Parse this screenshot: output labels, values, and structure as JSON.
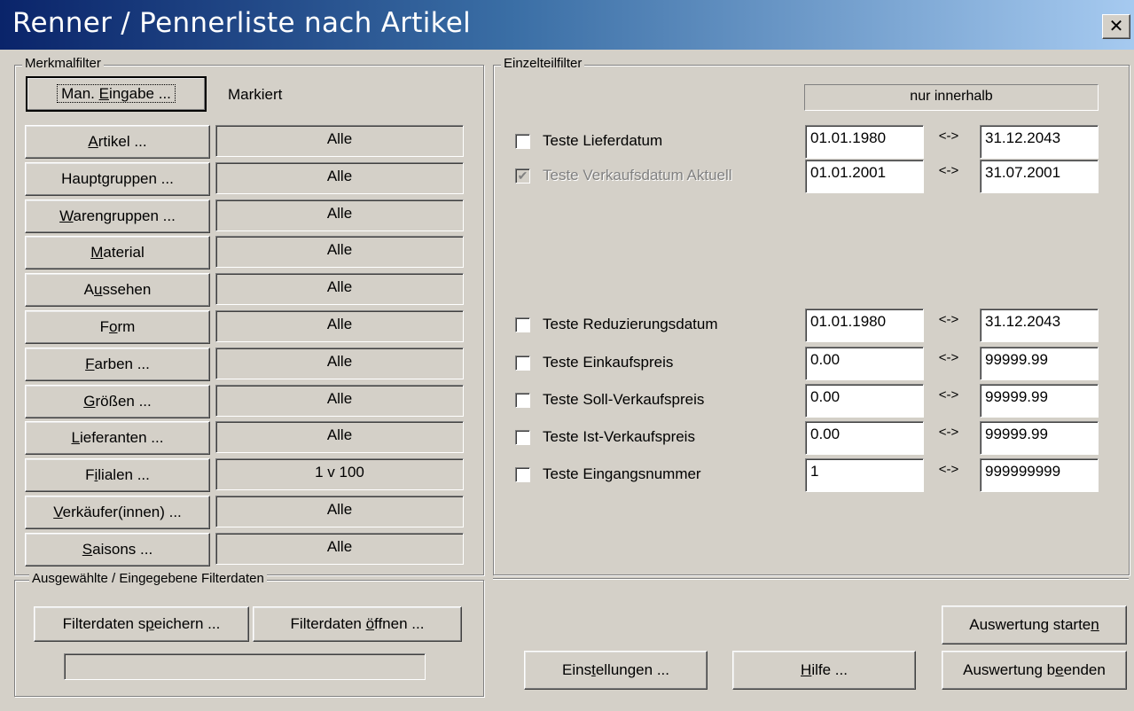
{
  "window": {
    "title": "Renner / Pennerliste nach Artikel",
    "close_glyph": "✕"
  },
  "merkmalfilter": {
    "legend": "Merkmalfilter",
    "man_eingabe": {
      "pre": "Man. ",
      "key": "E",
      "post": "ingabe ..."
    },
    "markiert": "Markiert",
    "rows": [
      {
        "pre": "",
        "key": "A",
        "post": "rtikel ...",
        "value": "Alle"
      },
      {
        "pre": "Haupt",
        "key": "g",
        "post": "ruppen ...",
        "value": "Alle"
      },
      {
        "pre": "",
        "key": "W",
        "post": "arengruppen ...",
        "value": "Alle"
      },
      {
        "pre": "",
        "key": "M",
        "post": "aterial",
        "value": "Alle"
      },
      {
        "pre": "A",
        "key": "u",
        "post": "ssehen",
        "value": "Alle"
      },
      {
        "pre": "F",
        "key": "o",
        "post": "rm",
        "value": "Alle"
      },
      {
        "pre": "",
        "key": "F",
        "post": "arben ...",
        "value": "Alle"
      },
      {
        "pre": "",
        "key": "G",
        "post": "rößen ...",
        "value": "Alle"
      },
      {
        "pre": "",
        "key": "L",
        "post": "ieferanten ...",
        "value": "Alle"
      },
      {
        "pre": "F",
        "key": "i",
        "post": "lialen ...",
        "value": "1 v 100"
      },
      {
        "pre": "",
        "key": "V",
        "post": "erkäufer(innen) ...",
        "value": "Alle"
      },
      {
        "pre": "",
        "key": "S",
        "post": "aisons ...",
        "value": "Alle"
      }
    ]
  },
  "filterdaten": {
    "legend": "Ausgewählte / Eingegebene Filterdaten",
    "save": {
      "pre": "Filterdaten s",
      "key": "p",
      "post": "eichern ..."
    },
    "open": {
      "pre": "Filterdaten ",
      "key": "ö",
      "post": "ffnen ..."
    },
    "status": ""
  },
  "einzelteilfilter": {
    "legend": "Einzelteilfilter",
    "header": "nur innerhalb",
    "separator": "<->",
    "rows": [
      {
        "label": "Teste Lieferdatum",
        "checked": false,
        "disabled": false,
        "from": "01.01.1980",
        "to": "31.12.2043"
      },
      {
        "label": "Teste Verkaufsdatum Aktuell",
        "checked": true,
        "disabled": true,
        "from": "01.01.2001",
        "to": "31.07.2001"
      },
      {
        "label": "Teste Reduzierungsdatum",
        "checked": false,
        "disabled": false,
        "from": "01.01.1980",
        "to": "31.12.2043"
      },
      {
        "label": "Teste Einkaufspreis",
        "checked": false,
        "disabled": false,
        "from": "0.00",
        "to": "99999.99"
      },
      {
        "label": "Teste Soll-Verkaufspreis",
        "checked": false,
        "disabled": false,
        "from": "0.00",
        "to": "99999.99"
      },
      {
        "label": "Teste Ist-Verkaufspreis",
        "checked": false,
        "disabled": false,
        "from": "0.00",
        "to": "99999.99"
      },
      {
        "label": "Teste Eingangsnummer",
        "checked": false,
        "disabled": false,
        "from": "1",
        "to": "999999999"
      }
    ]
  },
  "bottom": {
    "einstellungen": {
      "pre": "Eins",
      "key": "t",
      "post": "ellungen ..."
    },
    "hilfe": {
      "pre": "",
      "key": "H",
      "post": "ilfe ..."
    },
    "start": {
      "pre": "Auswertung starte",
      "key": "n",
      "post": ""
    },
    "end": {
      "pre": "Auswertung b",
      "key": "e",
      "post": "enden"
    }
  }
}
